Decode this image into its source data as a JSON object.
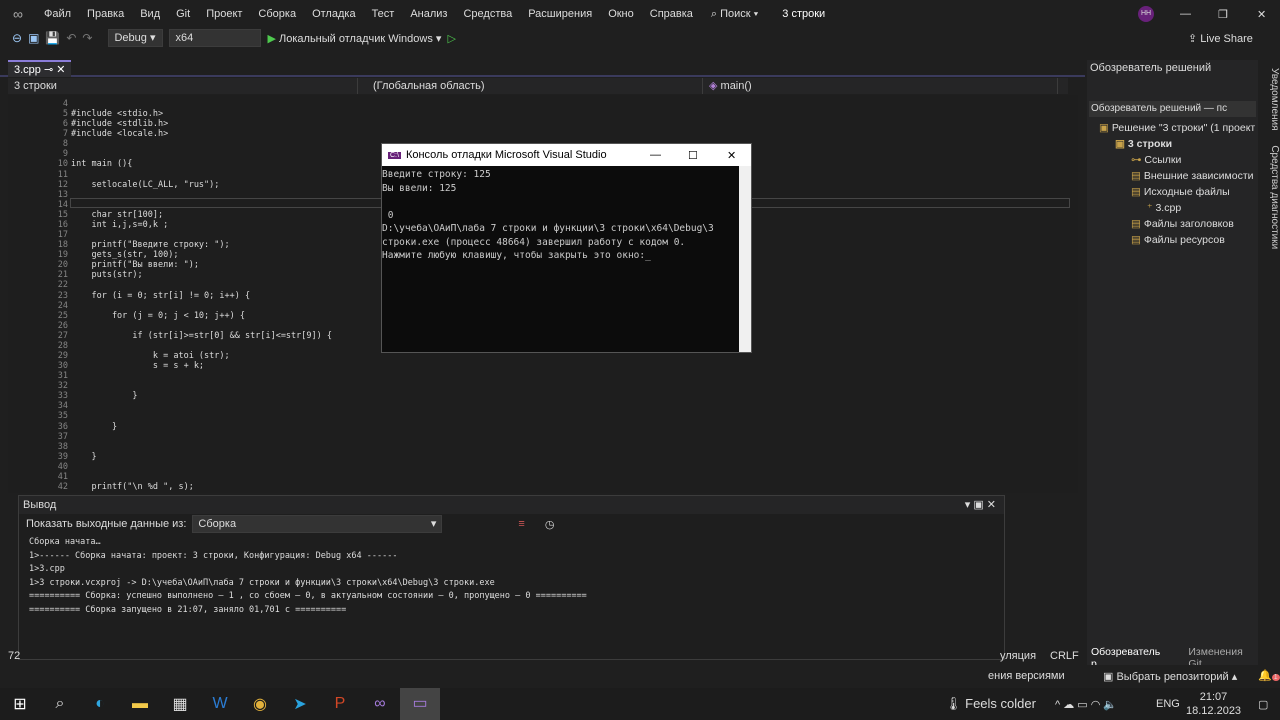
{
  "titlebar": {
    "menus": [
      "Файл",
      "Правка",
      "Вид",
      "Git",
      "Проект",
      "Сборка",
      "Отладка",
      "Тест",
      "Анализ",
      "Средства",
      "Расширения",
      "Окно",
      "Справка"
    ],
    "search": "Поиск",
    "solution_title": "3 строки",
    "avatar": "НН"
  },
  "toolbar": {
    "config": "Debug",
    "platform": "x64",
    "run_label": "Локальный отладчик Windows",
    "live_share": "Live Share"
  },
  "editor": {
    "tab": "3.cpp",
    "nav": {
      "project": "3 строки",
      "scope": "(Глобальная область)",
      "member": "main()"
    },
    "lines": [
      {
        "n": "4",
        "t": ""
      },
      {
        "n": "5",
        "t": "#include <stdio.h>"
      },
      {
        "n": "6",
        "t": "#include <stdlib.h>"
      },
      {
        "n": "7",
        "t": "#include <locale.h>"
      },
      {
        "n": "8",
        "t": ""
      },
      {
        "n": "9",
        "t": ""
      },
      {
        "n": "10",
        "t": "int main (){"
      },
      {
        "n": "11",
        "t": ""
      },
      {
        "n": "12",
        "t": "    setlocale(LC_ALL, \"rus\");"
      },
      {
        "n": "13",
        "t": ""
      },
      {
        "n": "14",
        "t": ""
      },
      {
        "n": "15",
        "t": "    char str[100];"
      },
      {
        "n": "16",
        "t": "    int i,j,s=0,k ;"
      },
      {
        "n": "17",
        "t": ""
      },
      {
        "n": "18",
        "t": "    printf(\"Введите строку: \");"
      },
      {
        "n": "19",
        "t": "    gets_s(str, 100);"
      },
      {
        "n": "20",
        "t": "    printf(\"Вы ввели: \");"
      },
      {
        "n": "21",
        "t": "    puts(str);"
      },
      {
        "n": "22",
        "t": ""
      },
      {
        "n": "23",
        "t": "    for (i = 0; str[i] != 0; i++) {"
      },
      {
        "n": "24",
        "t": ""
      },
      {
        "n": "25",
        "t": "        for (j = 0; j < 10; j++) {"
      },
      {
        "n": "26",
        "t": ""
      },
      {
        "n": "27",
        "t": "            if (str[i]>=str[0] && str[i]<=str[9]) {"
      },
      {
        "n": "28",
        "t": ""
      },
      {
        "n": "29",
        "t": "                k = atoi (str);"
      },
      {
        "n": "30",
        "t": "                s = s + k;"
      },
      {
        "n": "31",
        "t": ""
      },
      {
        "n": "32",
        "t": ""
      },
      {
        "n": "33",
        "t": "            }"
      },
      {
        "n": "34",
        "t": ""
      },
      {
        "n": "35",
        "t": ""
      },
      {
        "n": "36",
        "t": "        }"
      },
      {
        "n": "37",
        "t": ""
      },
      {
        "n": "38",
        "t": ""
      },
      {
        "n": "39",
        "t": "    }"
      },
      {
        "n": "40",
        "t": ""
      },
      {
        "n": "41",
        "t": ""
      },
      {
        "n": "42",
        "t": "    printf(\"\\n %d \", s);"
      }
    ]
  },
  "console": {
    "title": "Консоль отладки Microsoft Visual Studio",
    "text": "Введите строку: 125\nВы ввели: 125\n\n 0\nD:\\учеба\\ОАиП\\лаба 7 строки и функции\\3 строки\\x64\\Debug\\3\nстроки.exe (процесс 48664) завершил работу с кодом 0.\nНажмите любую клавишу, чтобы закрыть это окно:_"
  },
  "output": {
    "title": "Вывод",
    "show_label": "Показать выходные данные из:",
    "source": "Сборка",
    "text": "Сборка начата…\n1>------ Сборка начата: проект: 3 строки, Конфигурация: Debug x64 ------\n1>3.cpp\n1>3 строки.vcxproj -> D:\\учеба\\ОАиП\\лаба 7 строки и функции\\3 строки\\x64\\Debug\\3 строки.exe\n========== Сборка: успешно выполнено — 1 , со сбоем — 0, в актуальном состоянии — 0, пропущено — 0 ==========\n========== Сборка запущено в 21:07, заняло 01,701 с =========="
  },
  "solution": {
    "title": "Обозреватель решений",
    "search": "Обозреватель решений — пс",
    "nodes": [
      {
        "label": "Решение \"3 строки\"  (1 проект",
        "lvl": 0
      },
      {
        "label": "3 строки",
        "lvl": 1,
        "bold": true
      },
      {
        "label": "Ссылки",
        "lvl": 2
      },
      {
        "label": "Внешние зависимости",
        "lvl": 2
      },
      {
        "label": "Исходные файлы",
        "lvl": 2
      },
      {
        "label": "3.cpp",
        "lvl": 3
      },
      {
        "label": "Файлы заголовков",
        "lvl": 2
      },
      {
        "label": "Файлы ресурсов",
        "lvl": 2
      }
    ],
    "tabs": [
      "Обозреватель р...",
      "Изменения Git"
    ]
  },
  "vstrip": [
    "Уведомления",
    "Средства диагностики"
  ],
  "status": {
    "left": "72",
    "encoding": "уляция",
    "eol": "CRLF",
    "vcs": "ения версиями",
    "repo": "Выбрать репозиторий",
    "notifications": "1"
  },
  "taskbar": {
    "weather": "Feels colder",
    "lang": "ENG",
    "time": "21:07",
    "date": "18.12.2023"
  }
}
